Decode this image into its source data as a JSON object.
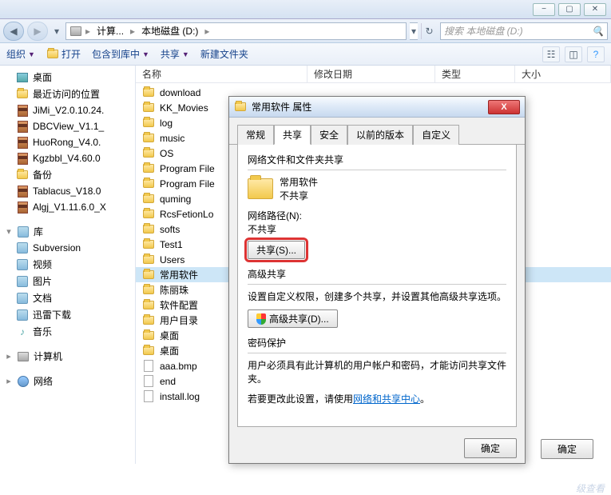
{
  "window_controls": {
    "min": "−",
    "max": "▢",
    "close": "✕"
  },
  "nav": {
    "crumbs": [
      "计算...",
      "本地磁盘 (D:)"
    ],
    "search_placeholder": "搜索 本地磁盘 (D:)"
  },
  "toolbar": {
    "organize": "组织",
    "open": "打开",
    "include": "包含到库中",
    "share": "共享",
    "newfolder": "新建文件夹"
  },
  "tree": {
    "favorites": {
      "items": [
        {
          "label": "桌面",
          "icon": "desk"
        },
        {
          "label": "最近访问的位置",
          "icon": "folder"
        },
        {
          "label": "JiMi_V2.0.10.24.",
          "icon": "rar"
        },
        {
          "label": "DBCView_V1.1_",
          "icon": "rar"
        },
        {
          "label": "HuoRong_V4.0.",
          "icon": "rar"
        },
        {
          "label": "Kgzbbl_V4.60.0",
          "icon": "rar"
        },
        {
          "label": "备份",
          "icon": "folder"
        },
        {
          "label": "Tablacus_V18.0",
          "icon": "rar"
        },
        {
          "label": "Algj_V1.11.6.0_X",
          "icon": "rar"
        }
      ]
    },
    "libraries": {
      "head": "库",
      "items": [
        {
          "label": "Subversion",
          "icon": "lib"
        },
        {
          "label": "视频",
          "icon": "lib"
        },
        {
          "label": "图片",
          "icon": "lib"
        },
        {
          "label": "文档",
          "icon": "lib"
        },
        {
          "label": "迅雷下载",
          "icon": "lib"
        },
        {
          "label": "音乐",
          "icon": "music"
        }
      ]
    },
    "computer": "计算机",
    "network": "网络"
  },
  "columns": {
    "name": "名称",
    "modified": "修改日期",
    "type": "类型",
    "size": "大小"
  },
  "files": [
    {
      "name": "download",
      "icon": "folder"
    },
    {
      "name": "KK_Movies",
      "icon": "folder"
    },
    {
      "name": "log",
      "icon": "folder"
    },
    {
      "name": "music",
      "icon": "folder",
      "sel": false
    },
    {
      "name": "OS",
      "icon": "folder"
    },
    {
      "name": "Program File",
      "icon": "folder"
    },
    {
      "name": "Program File",
      "icon": "folder"
    },
    {
      "name": "quming",
      "icon": "folder"
    },
    {
      "name": "RcsFetionLo",
      "icon": "folder"
    },
    {
      "name": "softs",
      "icon": "folder"
    },
    {
      "name": "Test1",
      "icon": "folder"
    },
    {
      "name": "Users",
      "icon": "folder"
    },
    {
      "name": "常用软件",
      "icon": "folder",
      "sel": true
    },
    {
      "name": "陈丽珠",
      "icon": "folder"
    },
    {
      "name": "软件配置",
      "icon": "folder"
    },
    {
      "name": "用户目录",
      "icon": "folder"
    },
    {
      "name": "桌面",
      "icon": "folder"
    },
    {
      "name": "桌面",
      "icon": "folder"
    },
    {
      "name": "aaa.bmp",
      "icon": "doc"
    },
    {
      "name": "end",
      "icon": "doc"
    },
    {
      "name": "install.log",
      "icon": "doc"
    }
  ],
  "dialog": {
    "title": "常用软件 属性",
    "tabs": [
      "常规",
      "共享",
      "安全",
      "以前的版本",
      "自定义"
    ],
    "active_tab": 1,
    "section1": {
      "heading": "网络文件和文件夹共享",
      "folder_name": "常用软件",
      "status": "不共享",
      "path_label": "网络路径(N):",
      "path_value": "不共享",
      "share_btn": "共享(S)..."
    },
    "section2": {
      "heading": "高级共享",
      "desc": "设置自定义权限，创建多个共享，并设置其他高级共享选项。",
      "btn": "高级共享(D)..."
    },
    "section3": {
      "heading": "密码保护",
      "desc1": "用户必须具有此计算机的用户帐户和密码，才能访问共享文件夹。",
      "desc2a": "若要更改此设置，请使用",
      "link": "网络和共享中心",
      "desc2b": "。"
    },
    "ok": "确定"
  },
  "outside_ok": "确定",
  "bg_text": "级查看"
}
